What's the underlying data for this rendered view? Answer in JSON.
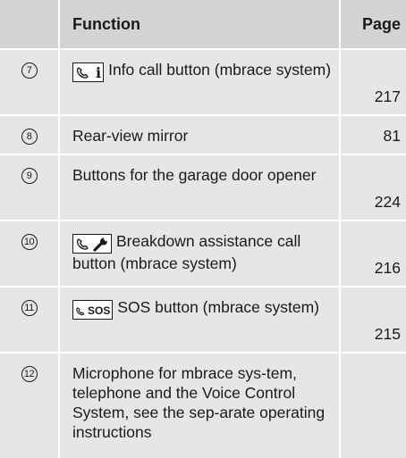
{
  "table": {
    "headers": {
      "number": "",
      "function": "Function",
      "page": "Page"
    },
    "rows": [
      {
        "num": "7",
        "icon": "phone-info-key-icon",
        "function": "Info call button (mbrace system)",
        "page": "217"
      },
      {
        "num": "8",
        "icon": "",
        "function": "Rear-view mirror",
        "page": "81"
      },
      {
        "num": "9",
        "icon": "",
        "function": "Buttons for the garage door opener",
        "page": "224"
      },
      {
        "num": "10",
        "icon": "phone-wrench-key-icon",
        "function": "Breakdown assistance call button (mbrace system)",
        "page": "216"
      },
      {
        "num": "11",
        "icon": "phone-sos-key-icon",
        "function": "SOS button (mbrace system)",
        "page": "215"
      },
      {
        "num": "12",
        "icon": "",
        "function": "Microphone for mbrace sys-tem, telephone and the Voice Control System, see the sep-arate operating instructions",
        "page": ""
      }
    ],
    "key_labels": {
      "info": "i",
      "sos": "SOS"
    }
  }
}
